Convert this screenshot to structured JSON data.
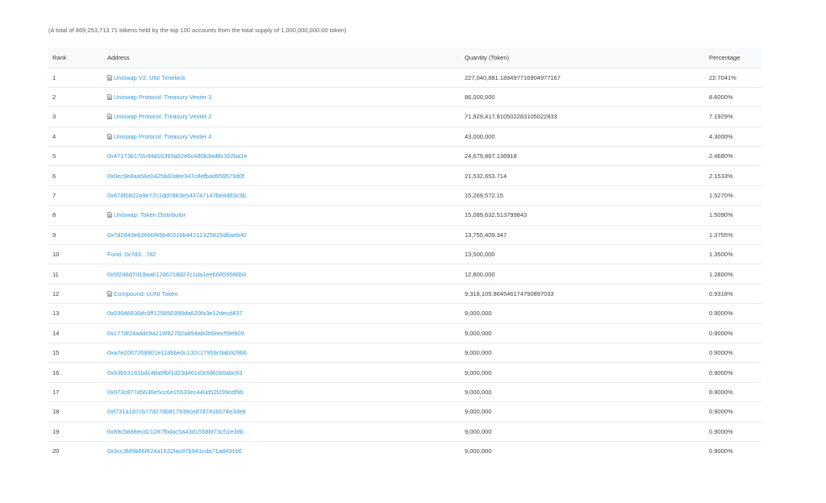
{
  "summary": "(A total of 869,253,713.71 tokens held by the top 100 accounts from the total supply of 1,000,000,000.00 token)",
  "columns": {
    "rank": "Rank",
    "address": "Address",
    "quantity": "Quantity (Token)",
    "percentage": "Percentage"
  },
  "rows": [
    {
      "rank": "1",
      "address": "Uniswap V2: UNI Timelock",
      "contract": true,
      "quantity": "227,040,881.189497716904977167",
      "percentage": "22.7041%"
    },
    {
      "rank": "2",
      "address": "Uniswap Protocol: Treasury Vester 3",
      "contract": true,
      "quantity": "86,000,000",
      "percentage": "8.6000%"
    },
    {
      "rank": "3",
      "address": "Uniswap Protocol: Treasury Vester 2",
      "contract": true,
      "quantity": "71,929,417.810502283105022833",
      "percentage": "7.1929%"
    },
    {
      "rank": "4",
      "address": "Uniswap Protocol: Treasury Vester 4",
      "contract": true,
      "quantity": "43,000,000",
      "percentage": "4.3000%"
    },
    {
      "rank": "5",
      "address": "0x47173b170c64d16393a52e6c480b3ad8c302ba1e",
      "contract": false,
      "quantity": "24,679,867.136918",
      "percentage": "2.4680%"
    },
    {
      "rank": "6",
      "address": "0x0ec9e8aa56e0425b60dee347c8efbad959579d0f",
      "contract": false,
      "quantity": "21,532,653.714",
      "percentage": "2.1533%"
    },
    {
      "rank": "7",
      "address": "0x878f0822a9e77c1dd7883e543747147be8d63c3b",
      "contract": false,
      "quantity": "15,269,572.15",
      "percentage": "1.5270%"
    },
    {
      "rank": "8",
      "address": "Uniswap: Token Distributor",
      "contract": true,
      "quantity": "15,089,632.513799843",
      "percentage": "1.5090%"
    },
    {
      "rank": "9",
      "address": "0x7d2d43e63666f45b40316b44212325625dbaeb40",
      "contract": false,
      "quantity": "13,755,409.347",
      "percentage": "1.3755%"
    },
    {
      "rank": "10",
      "address": "Fund: 0x7d3...782",
      "contract": false,
      "quantity": "13,500,000",
      "percentage": "1.3500%"
    },
    {
      "rank": "11",
      "address": "0x5f246d7d19aa612d6718d27c1da1ee66859586b0",
      "contract": false,
      "quantity": "12,800,000",
      "percentage": "1.2800%"
    },
    {
      "rank": "12",
      "address": "Compound: cUNI Token",
      "contract": true,
      "quantity": "9,318,105.864546174790897033",
      "percentage": "0.9318%"
    },
    {
      "rank": "13",
      "address": "0x030d6830dc8ff125850390da620fa3e12decd437",
      "contract": false,
      "quantity": "9,000,000",
      "percentage": "0.9000%"
    },
    {
      "rank": "14",
      "address": "0x177df24addc9a216f927d2a894ab0b6eec59eb09",
      "contract": false,
      "quantity": "9,000,000",
      "percentage": "0.9000%"
    },
    {
      "rank": "15",
      "address": "0xa7e2067268901e118bbe0c132c17959c9ab929b6",
      "contract": false,
      "quantity": "9,000,000",
      "percentage": "0.9000%"
    },
    {
      "rank": "16",
      "address": "0x63b53181bdc48a9fbf1d23d461d3cfd82b0abc83",
      "contract": false,
      "quantity": "9,000,000",
      "percentage": "0.9000%"
    },
    {
      "rank": "17",
      "address": "0x973c877d5636e5cc6e15533ec440d52f299cdf9b",
      "contract": false,
      "quantity": "9,000,000",
      "percentage": "0.9000%"
    },
    {
      "rank": "18",
      "address": "0xf731a187cb77d278b817939ce874741b074e3de8",
      "contract": false,
      "quantity": "9,000,000",
      "percentage": "0.9000%"
    },
    {
      "rank": "19",
      "address": "0x89c5888ecd21287fbdac5a43d1558bf73c51e38b",
      "contract": false,
      "quantity": "9,000,000",
      "percentage": "0.9000%"
    },
    {
      "rank": "20",
      "address": "0x3cc3bf9b66f424a1632fac87b941cda71ad491b6",
      "contract": false,
      "quantity": "9,000,000",
      "percentage": "0.9000%"
    }
  ],
  "colors": {
    "link": "#3498db",
    "header_bg": "#f8f9fa",
    "row_border": "#e7eaf3"
  },
  "icons": {
    "contract": "file-document-icon"
  }
}
